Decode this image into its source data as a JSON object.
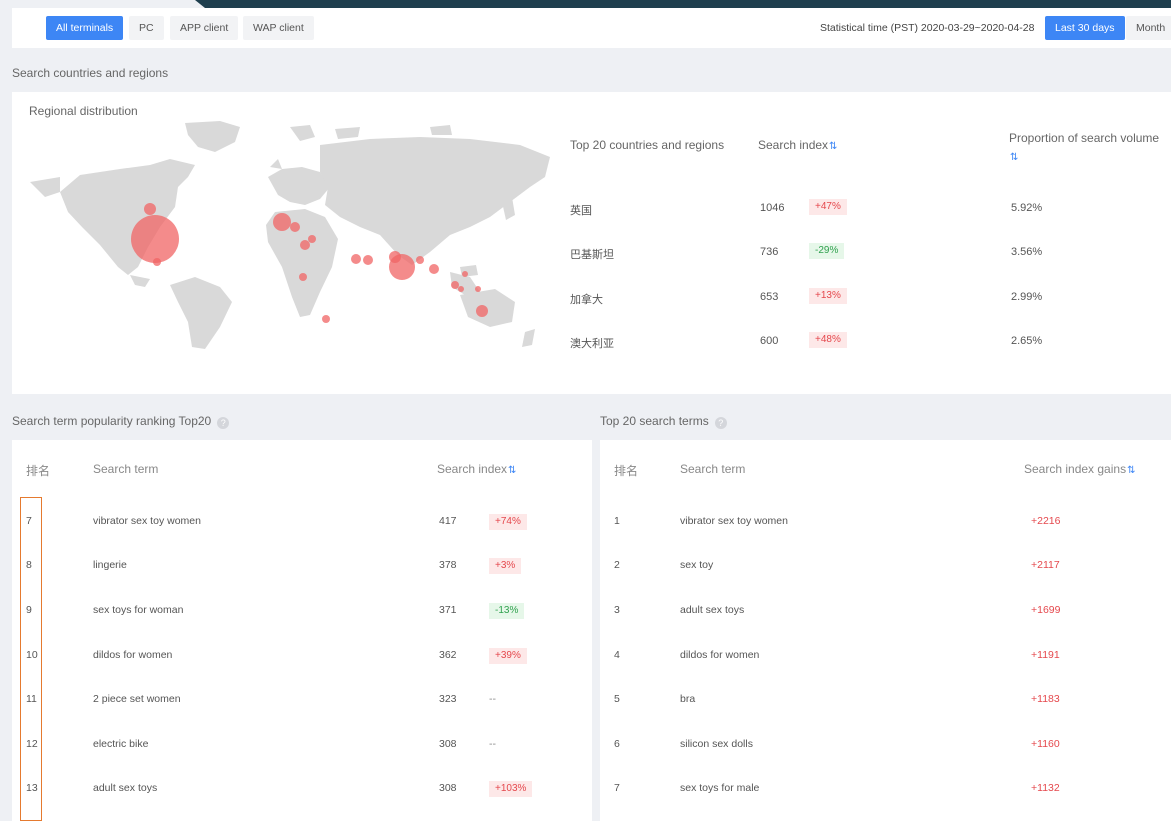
{
  "filters": {
    "terminals": [
      {
        "label": "All terminals",
        "active": true
      },
      {
        "label": "PC",
        "active": false
      },
      {
        "label": "APP client",
        "active": false
      },
      {
        "label": "WAP client",
        "active": false
      }
    ],
    "statistical_time": "Statistical time (PST) 2020-03-29~2020-04-28",
    "periods": [
      {
        "label": "Last 30 days",
        "active": true
      },
      {
        "label": "Month",
        "active": false
      }
    ]
  },
  "regions": {
    "section_title": "Search countries and regions",
    "map_label": "Regional distribution",
    "headers": {
      "country": "Top 20 countries and regions",
      "index": "Search index",
      "proportion": "Proportion of search volume"
    },
    "sort_icon": "⇅",
    "rows": [
      {
        "country": "英国",
        "index": "1046",
        "change": "+47%",
        "trend": "up",
        "proportion": "5.92%"
      },
      {
        "country": "巴基斯坦",
        "index": "736",
        "change": "-29%",
        "trend": "down",
        "proportion": "3.56%"
      },
      {
        "country": "加拿大",
        "index": "653",
        "change": "+13%",
        "trend": "up",
        "proportion": "2.99%"
      },
      {
        "country": "澳大利亚",
        "index": "600",
        "change": "+48%",
        "trend": "up",
        "proportion": "2.65%"
      }
    ]
  },
  "popularity": {
    "title": "Search term popularity ranking Top20",
    "help_icon": "?",
    "headers": {
      "rank": "排名",
      "term": "Search term",
      "index": "Search index"
    },
    "rows": [
      {
        "rank": "7",
        "term": "vibrator sex toy women",
        "index": "417",
        "change": "+74%",
        "trend": "up"
      },
      {
        "rank": "8",
        "term": "lingerie",
        "index": "378",
        "change": "+3%",
        "trend": "up"
      },
      {
        "rank": "9",
        "term": "sex toys for woman",
        "index": "371",
        "change": "-13%",
        "trend": "down"
      },
      {
        "rank": "10",
        "term": "dildos for women",
        "index": "362",
        "change": "+39%",
        "trend": "up"
      },
      {
        "rank": "11",
        "term": "2 piece set women",
        "index": "323",
        "change": "--",
        "trend": "none"
      },
      {
        "rank": "12",
        "term": "electric bike",
        "index": "308",
        "change": "--",
        "trend": "none"
      },
      {
        "rank": "13",
        "term": "adult sex toys",
        "index": "308",
        "change": "+103%",
        "trend": "up"
      }
    ]
  },
  "top_terms": {
    "title": "Top 20 search terms",
    "help_icon": "?",
    "headers": {
      "rank": "排名",
      "term": "Search term",
      "gains": "Search index gains"
    },
    "rows": [
      {
        "rank": "1",
        "term": "vibrator sex toy women",
        "gain": "+2216"
      },
      {
        "rank": "2",
        "term": "sex toy",
        "gain": "+2117"
      },
      {
        "rank": "3",
        "term": "adult sex toys",
        "gain": "+1699"
      },
      {
        "rank": "4",
        "term": "dildos for women",
        "gain": "+1191"
      },
      {
        "rank": "5",
        "term": "bra",
        "gain": "+1183"
      },
      {
        "rank": "6",
        "term": "silicon sex dolls",
        "gain": "+1160"
      },
      {
        "rank": "7",
        "term": "sex toys for male",
        "gain": "+1132"
      }
    ]
  },
  "colors": {
    "accent": "#3d86f5",
    "bubble": "#f06464",
    "up": "#e5484d",
    "down": "#30a14e",
    "highlight": "#e57a2f"
  }
}
